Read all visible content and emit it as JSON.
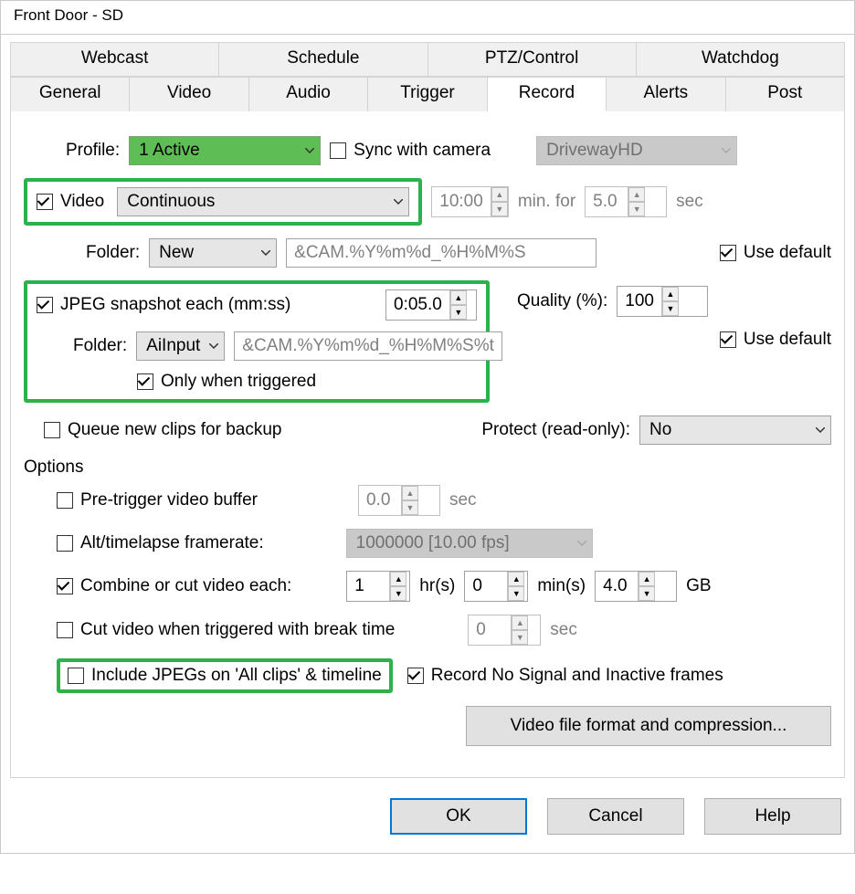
{
  "title": "Front Door - SD",
  "tabs_row1": [
    "Webcast",
    "Schedule",
    "PTZ/Control",
    "Watchdog"
  ],
  "tabs_row2": [
    "General",
    "Video",
    "Audio",
    "Trigger",
    "Record",
    "Alerts",
    "Post"
  ],
  "active_tab": "Record",
  "profile": {
    "label": "Profile:",
    "value": "1   Active",
    "sync_label": "Sync with camera",
    "sync_checked": false,
    "camera_value": "DrivewayHD"
  },
  "video": {
    "checkbox_label": "Video",
    "checked": true,
    "mode": "Continuous",
    "time": "10:00",
    "time_unit": "min. for",
    "sec_value": "5.0",
    "sec_unit": "sec"
  },
  "video_folder": {
    "label": "Folder:",
    "value": "New",
    "pattern": "&CAM.%Y%m%d_%H%M%S",
    "use_default_label": "Use default",
    "use_default": true
  },
  "jpeg": {
    "checkbox_label": "JPEG snapshot each (mm:ss)",
    "checked": true,
    "interval": "0:05.0",
    "quality_label": "Quality (%):",
    "quality": "100",
    "folder_label": "Folder:",
    "folder_value": "AiInput",
    "pattern": "&CAM.%Y%m%d_%H%M%S%t",
    "use_default_label": "Use default",
    "use_default": true,
    "only_triggered_label": "Only when triggered",
    "only_triggered": true
  },
  "queue_backup": {
    "label": "Queue new clips for backup",
    "checked": false
  },
  "protect": {
    "label": "Protect (read-only):",
    "value": "No"
  },
  "options_title": "Options",
  "pretrigger": {
    "label": "Pre-trigger video buffer",
    "checked": false,
    "value": "0.0",
    "unit": "sec"
  },
  "altfps": {
    "label": "Alt/timelapse framerate:",
    "checked": false,
    "value": "1000000 [10.00 fps]"
  },
  "combine": {
    "label": "Combine or cut video each:",
    "checked": true,
    "hrs": "1",
    "hrs_unit": "hr(s)",
    "mins": "0",
    "mins_unit": "min(s)",
    "gb": "4.0",
    "gb_unit": "GB"
  },
  "cutbreak": {
    "label": "Cut video when triggered with break time",
    "checked": false,
    "value": "0",
    "unit": "sec"
  },
  "include_jpegs": {
    "label": "Include JPEGs on 'All clips' & timeline",
    "checked": false
  },
  "record_nosignal": {
    "label": "Record No Signal and Inactive frames",
    "checked": true
  },
  "format_button": "Video file format and compression...",
  "buttons": {
    "ok": "OK",
    "cancel": "Cancel",
    "help": "Help"
  }
}
